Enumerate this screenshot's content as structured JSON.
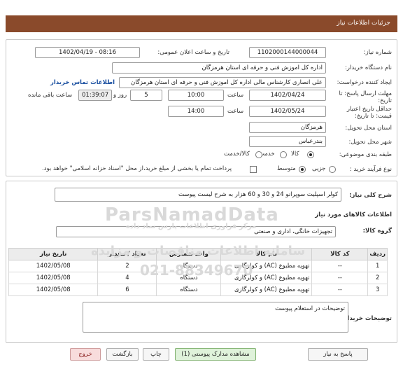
{
  "header": {
    "title": "جزئیات اطلاعات نیاز"
  },
  "form": {
    "need_number_label": "شماره نیاز:",
    "need_number": "1102000144000044",
    "announce_label": "تاریخ و ساعت اعلان عمومی:",
    "announce_value": "1402/04/19 - 08:16",
    "buyer_label": "نام دستگاه خریدار:",
    "buyer_value": "اداره کل اموزش فنی و حرفه ای استان هرمزگان",
    "creator_label": "ایجاد کننده درخواست:",
    "creator_value": "علی انصاری کارشناس مالی اداره کل اموزش فنی و حرفه ای استان هرمزگان",
    "contact_link": "اطلاعات تماس خریدار",
    "deadline_label": "مهلت ارسال پاسخ: تا تاریخ:",
    "deadline_date": "1402/04/24",
    "time_label": "ساعت",
    "deadline_time": "10:00",
    "days_value": "5",
    "days_label": "روز و",
    "remaining_value": "01:39:07",
    "remaining_label": "ساعت باقی مانده",
    "validity_label": "حداقل تاریخ اعتبار قیمت: تا تاریخ:",
    "validity_date": "1402/05/24",
    "validity_time": "14:00",
    "province_label": "استان محل تحویل:",
    "province_value": "هرمزگان",
    "city_label": "شهر محل تحویل:",
    "city_value": "بندرعباس",
    "category_label": "طبقه بندی موضوعی:",
    "category_options": [
      "کالا",
      "خدمت",
      "کالا/خدمت"
    ],
    "category_selected": "کالا",
    "process_label": "نوع فرآیند خرید :",
    "process_options": [
      "جزیی",
      "متوسط"
    ],
    "process_selected": "متوسط",
    "payment_note": "پرداخت تمام یا بخشی از مبلغ خرید،از محل \"اسناد خزانه اسلامی\" خواهد بود."
  },
  "need": {
    "summary_label": "شرح کلی نیاز:",
    "summary_value": "کولر اسپلیت سوپرانو 24 و 30 و 60 هزار به شرح لیست پیوست",
    "goods_info_title": "اطلاعات کالاهای مورد نیاز",
    "group_label": "گروه کالا:",
    "group_value": "تجهیزات خانگی، اداری و صنعتی",
    "table": {
      "headers": [
        "ردیف",
        "کد کالا",
        "نام کالا",
        "واحد شمارش",
        "تعداد / مقدار",
        "تاریخ نیاز"
      ],
      "rows": [
        [
          "1",
          "--",
          "تهویه مطبوع (AC) و کولرگازی",
          "دستگاه",
          "2",
          "1402/05/08"
        ],
        [
          "2",
          "--",
          "تهویه مطبوع (AC) و کولرگازی",
          "دستگاه",
          "4",
          "1402/05/08"
        ],
        [
          "3",
          "--",
          "تهویه مطبوع (AC) و کولرگازی",
          "دستگاه",
          "6",
          "1402/05/08"
        ]
      ]
    },
    "buyer_notes_label": "توضیحات خریدار:",
    "buyer_notes_value": "توضیحات در استعلام پیوست"
  },
  "buttons": {
    "reply": "پاسخ به نیاز",
    "attachments": "مشاهده مدارک پیوستی (1)",
    "print": "چاپ",
    "back": "بازگشت",
    "exit": "خروج"
  },
  "watermark": {
    "brand": "ParsNamadData",
    "fa_line1": "مرکز فراوری اطلاعات پارس نماد داده",
    "fa_line2": "سامانه اطلاعات مناقصات و مزایده",
    "phone": "021-88349670"
  },
  "colors": {
    "title_bar": "#8a4a2b",
    "link": "#1a4fa0"
  }
}
